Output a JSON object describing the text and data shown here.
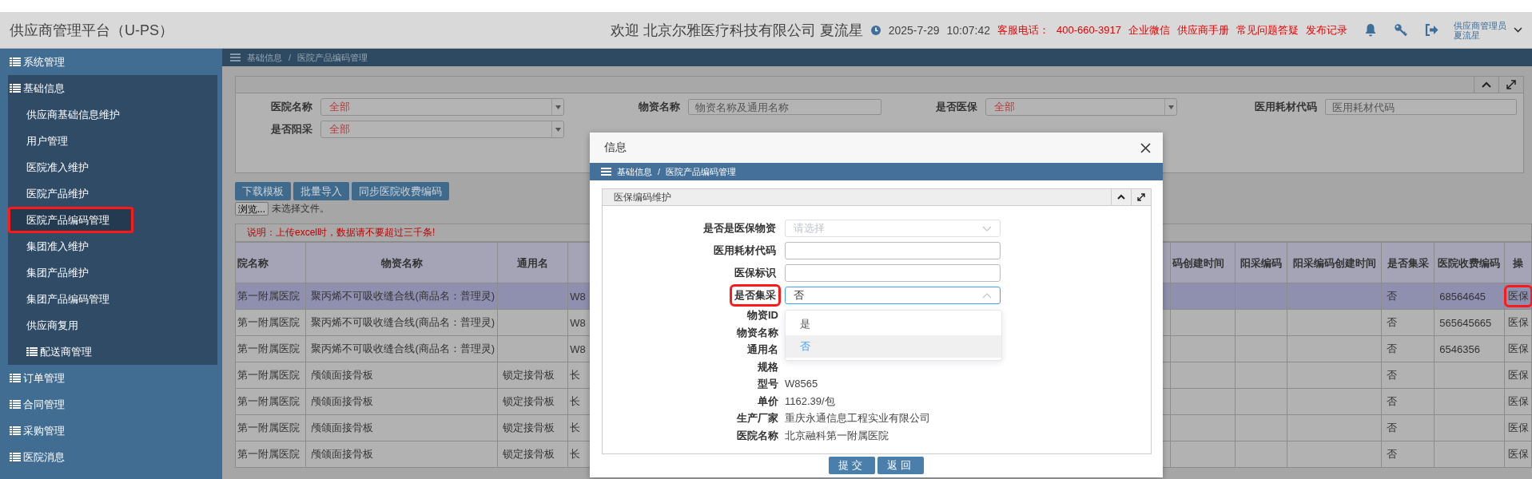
{
  "header": {
    "title": "供应商管理平台（U-PS）",
    "welcome": "欢迎 北京尔雅医疗科技有限公司 夏流星",
    "date": "2025-7-29",
    "time": "10:07:42",
    "hotline_label": "客服电话：",
    "hotline": "400-660-3917",
    "links": [
      "企业微信",
      "供应商手册",
      "常见问题答疑",
      "发布记录"
    ],
    "user": {
      "role": "供应商管理员",
      "name": "夏流星"
    }
  },
  "sidebar": {
    "items": [
      {
        "label": "系统管理",
        "expanded": false
      },
      {
        "label": "基础信息",
        "expanded": true,
        "children": [
          {
            "label": "供应商基础信息维护",
            "kind": "page",
            "selected": false,
            "highlighted": false
          },
          {
            "label": "用户管理",
            "kind": "page",
            "selected": false,
            "highlighted": false
          },
          {
            "label": "医院准入维护",
            "kind": "page",
            "selected": false,
            "highlighted": false
          },
          {
            "label": "医院产品维护",
            "kind": "page",
            "selected": false,
            "highlighted": false
          },
          {
            "label": "医院产品编码管理",
            "kind": "page",
            "selected": true,
            "highlighted": true
          },
          {
            "label": "集团准入维护",
            "kind": "page",
            "selected": false,
            "highlighted": false
          },
          {
            "label": "集团产品维护",
            "kind": "page",
            "selected": false,
            "highlighted": false
          },
          {
            "label": "集团产品编码管理",
            "kind": "page",
            "selected": false,
            "highlighted": false
          },
          {
            "label": "供应商复用",
            "kind": "page",
            "selected": false,
            "highlighted": false
          },
          {
            "label": "配送商管理",
            "kind": "group",
            "selected": false,
            "highlighted": false
          }
        ]
      },
      {
        "label": "订单管理",
        "expanded": false
      },
      {
        "label": "合同管理",
        "expanded": false
      },
      {
        "label": "采购管理",
        "expanded": false
      },
      {
        "label": "医院消息",
        "expanded": false
      }
    ]
  },
  "breadcrumb": {
    "separator": "/",
    "items": [
      "基础信息",
      "医院产品编码管理"
    ]
  },
  "filters": [
    {
      "label": "医院名称",
      "kind": "select",
      "value": "全部"
    },
    {
      "label": "物资名称",
      "kind": "input",
      "placeholder": "物资名称及通用名称"
    },
    {
      "label": "是否医保",
      "kind": "select",
      "value": "全部"
    },
    {
      "label": "医用耗材代码",
      "kind": "input",
      "placeholder": "医用耗材代码"
    },
    {
      "label": "是否阳采",
      "kind": "select",
      "value": "全部"
    }
  ],
  "toolbar": {
    "buttons": [
      "下载模板",
      "批量导入",
      "同步医院收费编码"
    ],
    "file_button": "浏览...",
    "file_status": "未选择文件。"
  },
  "notice": "说明：上传excel时，数据请不要超过三千条!",
  "table": {
    "left_columns": [
      "院名称",
      "物资名称",
      "通用名"
    ],
    "right_columns": [
      "码创建时间",
      "阳采编码",
      "阳采编码创建时间",
      "是否集采",
      "医院收费编码",
      "操"
    ],
    "rows": [
      {
        "selected": true,
        "action_highlighted": true,
        "hospital": "第一附属医院",
        "material": "聚丙烯不可吸收缝合线(商品名：普理灵)",
        "column_4": "W8",
        "centralized": "否",
        "fee_code": "68564645",
        "action": "医保"
      },
      {
        "selected": false,
        "action_highlighted": false,
        "hospital": "第一附属医院",
        "material": "聚丙烯不可吸收缝合线(商品名：普理灵)",
        "column_4": "W8",
        "centralized": "否",
        "fee_code": "565645665",
        "action": "医保"
      },
      {
        "selected": false,
        "action_highlighted": false,
        "hospital": "第一附属医院",
        "material": "聚丙烯不可吸收缝合线(商品名：普理灵)",
        "column_4": "W8",
        "centralized": "否",
        "fee_code": "6546356",
        "action": "医保"
      },
      {
        "selected": false,
        "action_highlighted": false,
        "hospital": "第一附属医院",
        "material": "颅颌面接骨板",
        "generic": "锁定接骨板",
        "column_4": "长",
        "centralized": "否",
        "action": "医保"
      },
      {
        "selected": false,
        "action_highlighted": false,
        "hospital": "第一附属医院",
        "material": "颅颌面接骨板",
        "generic": "锁定接骨板",
        "column_4": "长",
        "centralized": "否",
        "action": "医保"
      },
      {
        "selected": false,
        "action_highlighted": false,
        "hospital": "第一附属医院",
        "material": "颅颌面接骨板",
        "generic": "锁定接骨板",
        "column_4": "长",
        "centralized": "否",
        "action": "医保"
      },
      {
        "selected": false,
        "action_highlighted": false,
        "hospital": "第一附属医院",
        "material": "颅颌面接骨板",
        "generic": "锁定接骨板",
        "column_4": "长",
        "centralized": "否",
        "action": "医保"
      }
    ]
  },
  "modal": {
    "title": "信息",
    "breadcrumb": {
      "separator": "/",
      "items": [
        "基础信息",
        "医院产品编码管理"
      ]
    },
    "panel_title": "医保编码维护",
    "fields": [
      {
        "label": "是否是医保物资",
        "kind": "select",
        "placeholder": "请选择",
        "open": false,
        "highlighted": false
      },
      {
        "label": "医用耗材代码",
        "kind": "input",
        "highlighted": false
      },
      {
        "label": "医保标识",
        "kind": "input",
        "highlighted": false
      },
      {
        "label": "是否集采",
        "kind": "select",
        "value": "否",
        "open": true,
        "highlighted": true,
        "options": [
          {
            "label": "是",
            "selected": false
          },
          {
            "label": "否",
            "selected": true
          }
        ]
      }
    ],
    "details": [
      {
        "label": "物资ID"
      },
      {
        "label": "物资名称"
      },
      {
        "label": "通用名"
      },
      {
        "label": "规格"
      },
      {
        "label": "型号",
        "value": "W8565"
      },
      {
        "label": "单价",
        "value": "1162.39/包"
      },
      {
        "label": "生产厂家",
        "value": "重庆永通信息工程实业有限公司"
      },
      {
        "label": "医院名称",
        "value": "北京融科第一附属医院"
      }
    ],
    "buttons": [
      "提交",
      "返回"
    ]
  }
}
